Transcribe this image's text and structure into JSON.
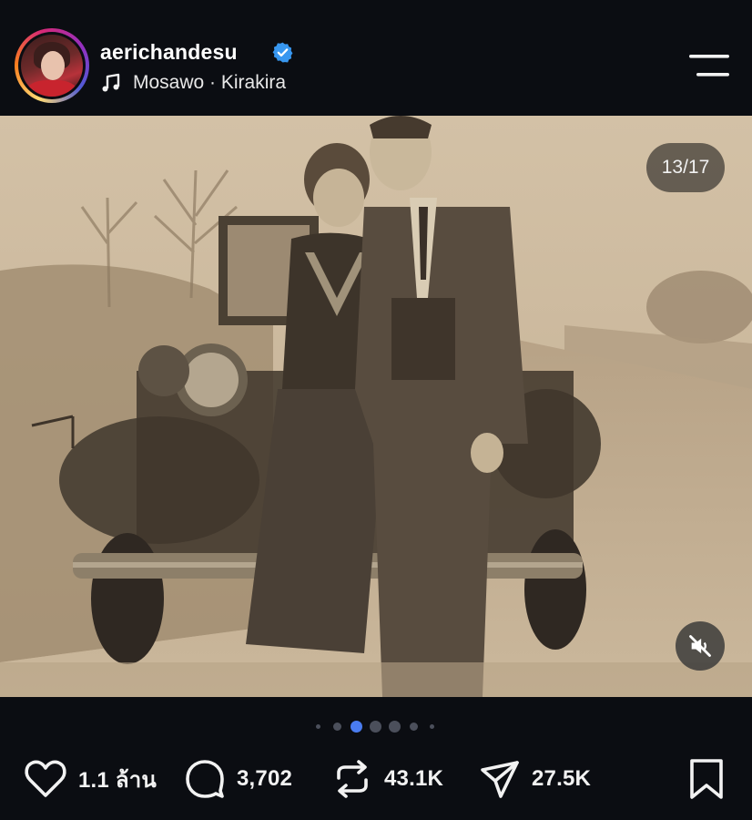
{
  "post": {
    "username": "aerichandesu",
    "verified": true,
    "audio": "Mosawo · Kirakira",
    "media_counter": "13/17",
    "muted": true
  },
  "carousel": {
    "total_dots": 6,
    "active_dot_index": 2
  },
  "actions": {
    "likes": "1.1 ล้าน",
    "comments": "3,702",
    "reposts": "43.1K",
    "shares": "27.5K"
  },
  "colors": {
    "background": "#0b0d12",
    "verified_blue": "#3897f0",
    "active_dot": "#4a7cf0",
    "inactive_dot": "#4b4f5b"
  },
  "icons": [
    "verified-badge-icon",
    "music-note-icon",
    "menu-icon",
    "mute-icon",
    "heart-icon",
    "comment-icon",
    "repost-icon",
    "share-icon",
    "bookmark-icon"
  ]
}
